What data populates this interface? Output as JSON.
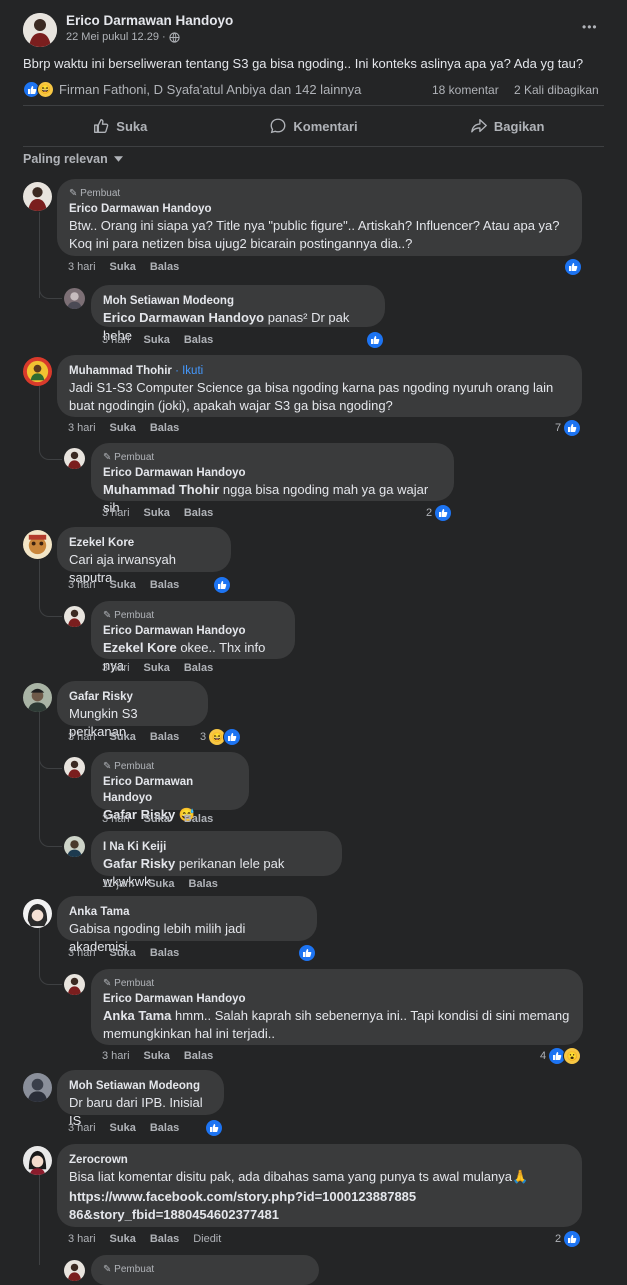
{
  "post": {
    "author": "Erico Darmawan Handoyo",
    "time": "22 Mei pukul 12.29 ·",
    "text": "Bbrp waktu ini berseliweran tentang S3 ga bisa ngoding.. Ini konteks aslinya apa ya? Ada yg tau?",
    "reactors": "Firman Fathoni, D Syafa'atul Anbiya dan 142 lainnya",
    "comment_count": "18 komentar",
    "share_count": "2 Kali dibagikan",
    "more": "•••"
  },
  "action_bar": {
    "like": "Suka",
    "comment": "Komentari",
    "share": "Bagikan"
  },
  "sort": {
    "label": "Paling relevan"
  },
  "labels": {
    "author_badge": "Pembuat",
    "follow": "· Ikuti",
    "like": "Suka",
    "reply": "Balas",
    "edited": "Diedit"
  },
  "comments": [
    {
      "author": "Erico Darmawan Handoyo",
      "text": "Btw.. Orang ini siapa ya? Title nya \"public figure\".. Artiskah? Influencer? Atau apa ya? Koq ini para netizen bisa ujug2 bicarain postingannya dia..?",
      "time": "3 hari"
    },
    {
      "author": "Moh Setiawan Modeong",
      "mention": "Erico Darmawan Handoyo",
      "text": " panas² Dr pak hehe",
      "time": "3 hari"
    },
    {
      "author": "Muhammad Thohir",
      "text": "Jadi S1-S3 Computer Science ga bisa ngoding karna pas ngoding nyuruh orang lain buat ngodingin (joki), apakah wajar S3 ga bisa ngoding?",
      "time": "3 hari",
      "reactions": "7"
    },
    {
      "author": "Erico Darmawan Handoyo",
      "mention": "Muhammad Thohir",
      "text": " ngga bisa ngoding mah ya ga wajar sih",
      "time": "3 hari",
      "reactions": "2"
    },
    {
      "author": "Ezekel Kore",
      "text": "Cari aja irwansyah saputra",
      "time": "3 hari"
    },
    {
      "author": "Erico Darmawan Handoyo",
      "mention": "Ezekel Kore",
      "text": " okee.. Thx info nya",
      "time": "3 hari"
    },
    {
      "author": "Gafar Risky",
      "text": "Mungkin S3 perikanan",
      "time": "3 hari",
      "reactions": "3"
    },
    {
      "author": "Erico Darmawan Handoyo",
      "mention": "Gafar Risky",
      "text": " 😅",
      "time": "3 hari"
    },
    {
      "author": "I Na Ki Keiji",
      "mention": "Gafar Risky",
      "text": " perikanan lele pak wkwkwk",
      "time": "11 jam"
    },
    {
      "author": "Anka Tama",
      "text": "Gabisa ngoding lebih milih jadi akademisi",
      "time": "3 hari"
    },
    {
      "author": "Erico Darmawan Handoyo",
      "mention": "Anka Tama",
      "text": " hmm.. Salah kaprah sih sebenernya ini.. Tapi kondisi di sini memang memungkinkan hal ini terjadi..",
      "time": "3 hari",
      "reactions": "4"
    },
    {
      "author": "Moh Setiawan Modeong",
      "text": "Dr baru dari IPB. Inisial IS",
      "time": "3 hari"
    },
    {
      "author": "Zerocrown",
      "text": "Bisa liat komentar disitu pak, ada dibahas sama yang punya ts awal mulanya🙏",
      "link": "https://www.facebook.com/story.php?id=100012388788586&story_fbid=1880454602377481",
      "time": "3 hari",
      "reactions": "2"
    }
  ]
}
